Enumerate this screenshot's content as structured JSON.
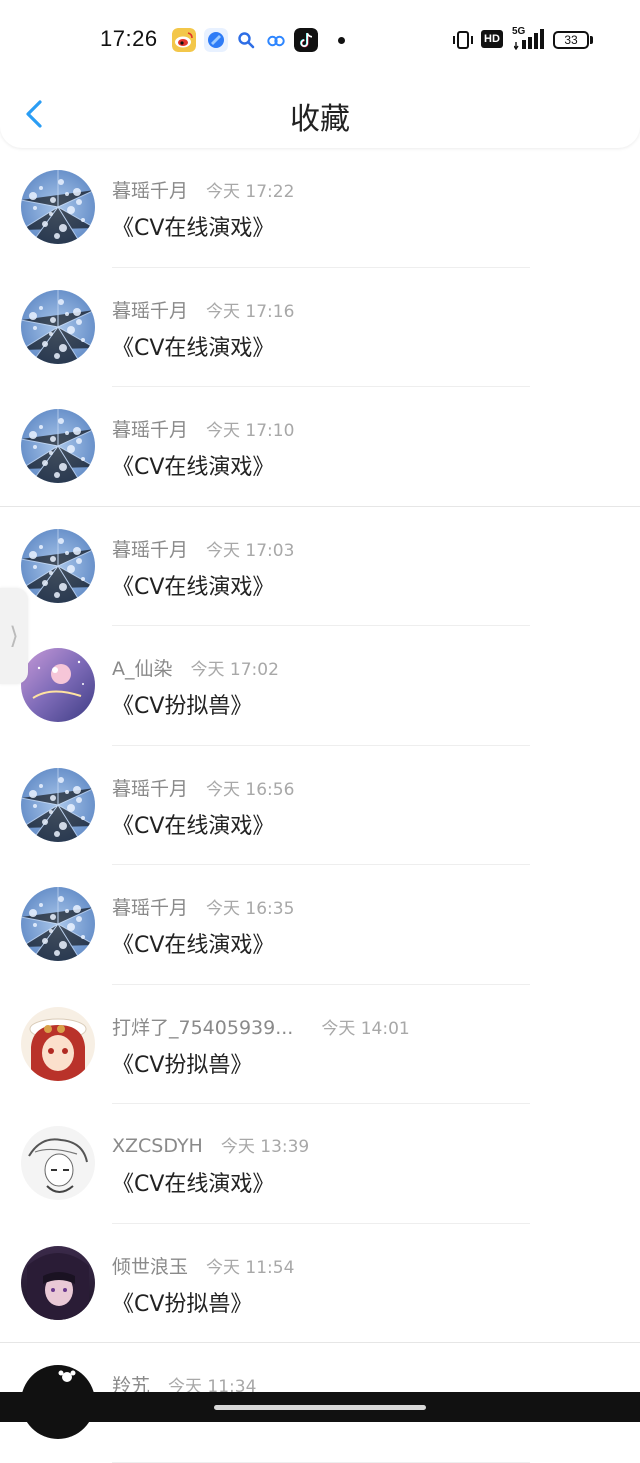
{
  "status_bar": {
    "time": "17:26",
    "network_label": "5G",
    "hd_label": "HD",
    "battery": "33",
    "app_icons": [
      "weibo-icon",
      "blue-app-icon",
      "search-app-icon",
      "link-app-icon",
      "tiktok-icon"
    ]
  },
  "header": {
    "title": "收藏",
    "back_icon": "chevron-left-icon"
  },
  "accent_color": "#2a9df4",
  "side_tab_glyph": "⟩",
  "favorites": [
    {
      "name": "暮瑶千月",
      "time": "今天 17:22",
      "title": "《CV在线演戏》",
      "avatar": "blue-crystal"
    },
    {
      "name": "暮瑶千月",
      "time": "今天 17:16",
      "title": "《CV在线演戏》",
      "avatar": "blue-crystal"
    },
    {
      "name": "暮瑶千月",
      "time": "今天 17:10",
      "title": "《CV在线演戏》",
      "avatar": "blue-crystal"
    },
    {
      "name": "暮瑶千月",
      "time": "今天 17:03",
      "title": "《CV在线演戏》",
      "avatar": "blue-crystal"
    },
    {
      "name": "A_仙染",
      "time": "今天 17:02",
      "title": "《CV扮拟兽》",
      "avatar": "purple-night"
    },
    {
      "name": "暮瑶千月",
      "time": "今天 16:56",
      "title": "《CV在线演戏》",
      "avatar": "blue-crystal"
    },
    {
      "name": "暮瑶千月",
      "time": "今天 16:35",
      "title": "《CV在线演戏》",
      "avatar": "blue-crystal"
    },
    {
      "name": "打烊了_75405939...",
      "time": "今天 14:01",
      "title": "《CV扮拟兽》",
      "avatar": "red-anime"
    },
    {
      "name": "XZCSDYH",
      "time": "今天 13:39",
      "title": "《CV在线演戏》",
      "avatar": "sketch"
    },
    {
      "name": "倾世浪玉",
      "time": "今天 11:54",
      "title": "《CV扮拟兽》",
      "avatar": "dark-purple"
    },
    {
      "name": "羚艽",
      "time": "今天 11:34",
      "title": "",
      "avatar": "black"
    }
  ]
}
